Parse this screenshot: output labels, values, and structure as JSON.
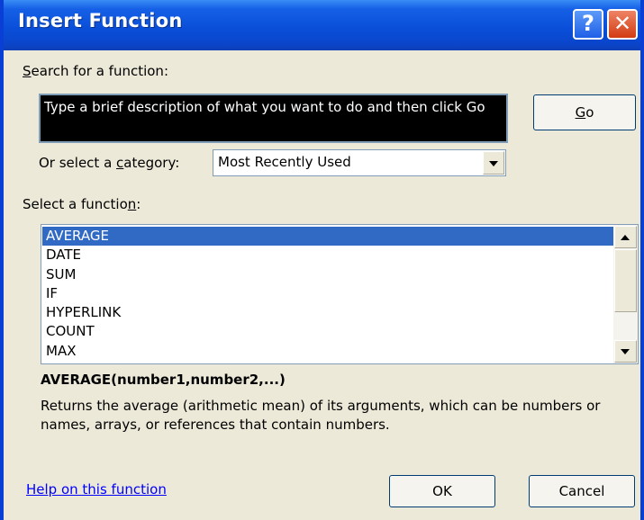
{
  "window": {
    "title": "Insert Function",
    "help_glyph": "?",
    "close_glyph": "✕"
  },
  "search": {
    "label_pre": "",
    "label_key": "S",
    "label_post": "earch for a function:",
    "value": "Type a brief description of what you want to do and then click Go",
    "go_button_key": "G",
    "go_button_rest": "o"
  },
  "category": {
    "label_pre": "Or select a ",
    "label_key": "c",
    "label_post": "ategory:",
    "selected": "Most Recently Used"
  },
  "functions": {
    "label_pre": "Select a functio",
    "label_key": "n",
    "label_post": ":",
    "items": [
      "AVERAGE",
      "DATE",
      "SUM",
      "IF",
      "HYPERLINK",
      "COUNT",
      "MAX"
    ],
    "selected_index": 0
  },
  "details": {
    "signature": "AVERAGE(number1,number2,...)",
    "description": "Returns the average (arithmetic mean) of its arguments, which can be numbers or names, arrays, or references that contain numbers."
  },
  "footer": {
    "help_link": "Help on this function",
    "ok_label": "OK",
    "cancel_label": "Cancel"
  },
  "colors": {
    "title_bar": "#0a4fd9",
    "selection": "#316ac5",
    "link": "#0000ff",
    "dialog_bg": "#ece9d8"
  }
}
